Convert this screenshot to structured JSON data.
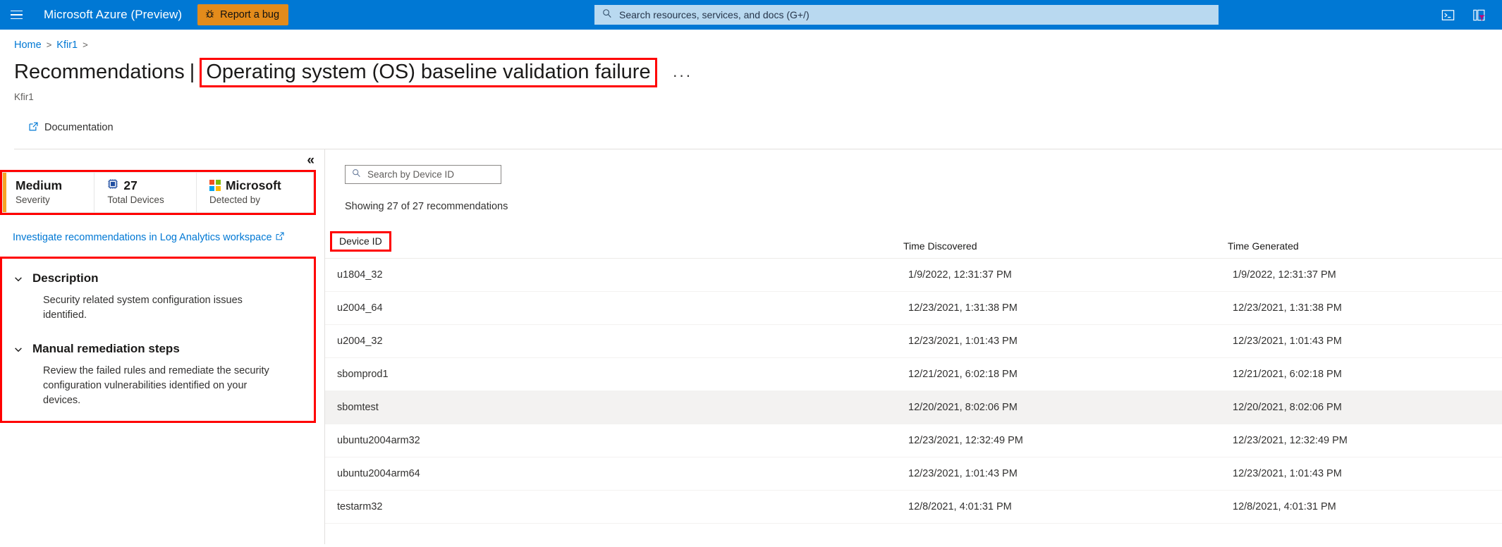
{
  "topbar": {
    "menu_icon": "hamburger-icon",
    "brand": "Microsoft Azure (Preview)",
    "report_bug_label": "Report a bug",
    "report_bug_icon": "bug-icon",
    "report_bug_color": "#E38B1B",
    "search_placeholder": "Search resources, services, and docs (G+/)",
    "search_icon": "search-icon",
    "cloud_shell_icon": "cloud-shell-icon",
    "directory_filter_icon": "directory-filter-icon",
    "background_color": "#0078D4"
  },
  "breadcrumb": {
    "items": [
      "Home",
      "Kfir1"
    ],
    "separator": ">"
  },
  "header": {
    "title": "Recommendations",
    "pipe": "|",
    "subtitle_title": "Operating system (OS) baseline validation failure",
    "ellipsis": "···",
    "resource": "Kfir1",
    "highlight_color": "#FF0000"
  },
  "commandbar": {
    "documentation_label": "Documentation",
    "documentation_icon": "external-link-icon"
  },
  "left_pane": {
    "collapse_icon": "chevron-double-left-icon",
    "collapse_glyph": "«",
    "stats": [
      {
        "value": "Medium",
        "label": "Severity",
        "icon": "severity-bar-icon",
        "accent": "#F7A325"
      },
      {
        "value": "27",
        "label": "Total Devices",
        "icon": "chip-icon"
      },
      {
        "value": "Microsoft",
        "label": "Detected by",
        "icon": "microsoft-logo-icon"
      }
    ],
    "investigate_link": "Investigate recommendations in Log Analytics workspace",
    "investigate_icon": "external-link-icon",
    "accordions": [
      {
        "title": "Description",
        "body": "Security related system configuration issues identified.",
        "icon": "chevron-down-icon",
        "expanded": true
      },
      {
        "title": "Manual remediation steps",
        "body": "Review the failed rules and remediate the security configuration vulnerabilities identified on your devices.",
        "icon": "chevron-down-icon",
        "expanded": true
      }
    ]
  },
  "right_pane": {
    "search_placeholder": "Search by Device ID",
    "search_value": "",
    "search_icon": "search-icon",
    "showing_text": "Showing 27 of 27 recommendations",
    "columns": [
      "Device ID",
      "Time Discovered",
      "Time Generated"
    ],
    "rows": [
      {
        "device_id": "u1804_32",
        "time_discovered": "1/9/2022, 12:31:37 PM",
        "time_generated": "1/9/2022, 12:31:37 PM"
      },
      {
        "device_id": "u2004_64",
        "time_discovered": "12/23/2021, 1:31:38 PM",
        "time_generated": "12/23/2021, 1:31:38 PM"
      },
      {
        "device_id": "u2004_32",
        "time_discovered": "12/23/2021, 1:01:43 PM",
        "time_generated": "12/23/2021, 1:01:43 PM"
      },
      {
        "device_id": "sbomprod1",
        "time_discovered": "12/21/2021, 6:02:18 PM",
        "time_generated": "12/21/2021, 6:02:18 PM"
      },
      {
        "device_id": "sbomtest",
        "time_discovered": "12/20/2021, 8:02:06 PM",
        "time_generated": "12/20/2021, 8:02:06 PM"
      },
      {
        "device_id": "ubuntu2004arm32",
        "time_discovered": "12/23/2021, 12:32:49 PM",
        "time_generated": "12/23/2021, 12:32:49 PM"
      },
      {
        "device_id": "ubuntu2004arm64",
        "time_discovered": "12/23/2021, 1:01:43 PM",
        "time_generated": "12/23/2021, 1:01:43 PM"
      },
      {
        "device_id": "testarm32",
        "time_discovered": "12/8/2021, 4:01:31 PM",
        "time_generated": "12/8/2021, 4:01:31 PM"
      }
    ]
  }
}
